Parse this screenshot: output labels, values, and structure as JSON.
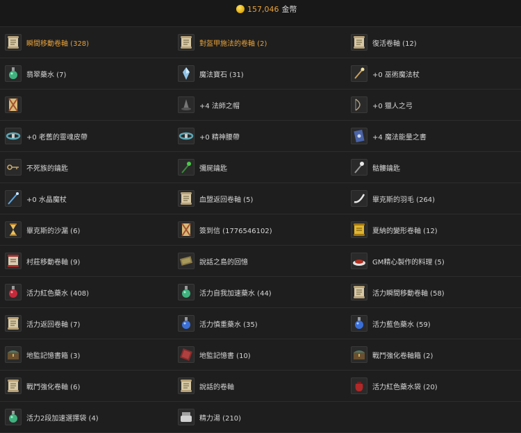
{
  "header": {
    "gold_amount": "157,046",
    "gold_unit": "金幣"
  },
  "colors": {
    "background": "#1e1e1e",
    "row_border": "#2d2d2d",
    "highlight_text": "#e8a23a",
    "normal_text": "#d6d6d6"
  },
  "rows": [
    {
      "cells": [
        {
          "label": "瞬間移動卷軸 (328)",
          "icon": "scroll-icon",
          "highlight": true
        },
        {
          "label": "對盔甲施法的卷軸 (2)",
          "icon": "scroll-icon",
          "highlight": true
        },
        {
          "label": "復活卷軸 (12)",
          "icon": "scroll-icon",
          "highlight": false
        }
      ]
    },
    {
      "cells": [
        {
          "label": "翡翠藥水 (7)",
          "icon": "green-potion-icon",
          "highlight": false
        },
        {
          "label": "魔法寶石 (31)",
          "icon": "crystal-icon",
          "highlight": false
        },
        {
          "label": "+0 巫術魔法杖",
          "icon": "wand-icon",
          "highlight": false
        }
      ]
    },
    {
      "cells": [
        {
          "label": "",
          "icon": "letter-icon",
          "highlight": false
        },
        {
          "label": "+4 法師之帽",
          "icon": "hat-icon",
          "highlight": false
        },
        {
          "label": "+0 獵人之弓",
          "icon": "bow-icon",
          "highlight": false
        }
      ]
    },
    {
      "cells": [
        {
          "label": "+0 老舊的靈魂皮帶",
          "icon": "belt-icon",
          "highlight": false
        },
        {
          "label": "+0 精神腰帶",
          "icon": "belt-icon",
          "highlight": false
        },
        {
          "label": "+4 魔法能量之書",
          "icon": "book-icon",
          "highlight": false
        }
      ]
    },
    {
      "cells": [
        {
          "label": "不死族的鑰匙",
          "icon": "key-icon",
          "highlight": false
        },
        {
          "label": "彌屍鑰匙",
          "icon": "green-staff-icon",
          "highlight": false
        },
        {
          "label": "骷髏鑰匙",
          "icon": "skull-staff-icon",
          "highlight": false
        }
      ]
    },
    {
      "cells": [
        {
          "label": "+0 水晶魔杖",
          "icon": "crystal-wand-icon",
          "highlight": false
        },
        {
          "label": "血盟返回卷軸 (5)",
          "icon": "scroll-icon",
          "highlight": false
        },
        {
          "label": "畢克斯的羽毛 (264)",
          "icon": "feather-icon",
          "highlight": false
        }
      ]
    },
    {
      "cells": [
        {
          "label": "畢克斯的沙漏 (6)",
          "icon": "hourglass-icon",
          "highlight": false
        },
        {
          "label": "簽到信 (1776546102)",
          "icon": "letter-icon",
          "highlight": false
        },
        {
          "label": "夏納的變形卷軸 (12)",
          "icon": "gold-scroll-icon",
          "highlight": false
        }
      ]
    },
    {
      "cells": [
        {
          "label": "村莊移動卷軸 (9)",
          "icon": "red-scroll-icon",
          "highlight": false
        },
        {
          "label": "說話之島的回憶",
          "icon": "map-icon",
          "highlight": false
        },
        {
          "label": "GM精心製作的料理 (5)",
          "icon": "food-icon",
          "highlight": false
        }
      ]
    },
    {
      "cells": [
        {
          "label": "活力紅色藥水 (408)",
          "icon": "red-potion-icon",
          "highlight": false
        },
        {
          "label": "活力自我加速藥水 (44)",
          "icon": "green-potion-icon",
          "highlight": false
        },
        {
          "label": "活力瞬間移動卷軸 (58)",
          "icon": "scroll-icon",
          "highlight": false
        }
      ]
    },
    {
      "cells": [
        {
          "label": "活力返回卷軸 (7)",
          "icon": "scroll-icon",
          "highlight": false
        },
        {
          "label": "活力慎重藥水 (35)",
          "icon": "blue-potion-icon",
          "highlight": false
        },
        {
          "label": "活力藍色藥水 (59)",
          "icon": "blue-potion-icon",
          "highlight": false
        }
      ]
    },
    {
      "cells": [
        {
          "label": "地監記憶書箱 (3)",
          "icon": "chest-icon",
          "highlight": false
        },
        {
          "label": "地監記憶書 (10)",
          "icon": "red-book-icon",
          "highlight": false
        },
        {
          "label": "戰鬥強化卷軸箱 (2)",
          "icon": "chest-icon",
          "highlight": false
        }
      ]
    },
    {
      "cells": [
        {
          "label": "戰鬥強化卷軸 (6)",
          "icon": "scroll-icon",
          "highlight": false
        },
        {
          "label": "說話的卷軸",
          "icon": "scroll-icon",
          "highlight": false
        },
        {
          "label": "活力紅色藥水袋 (20)",
          "icon": "potion-bag-icon",
          "highlight": false
        }
      ]
    },
    {
      "cells": [
        {
          "label": "活力2段加速選擇袋 (4)",
          "icon": "green-potion-icon",
          "highlight": false
        },
        {
          "label": "精力湯 (210)",
          "icon": "soup-icon",
          "highlight": false
        },
        {
          "label": "",
          "icon": "",
          "highlight": false
        }
      ]
    }
  ]
}
